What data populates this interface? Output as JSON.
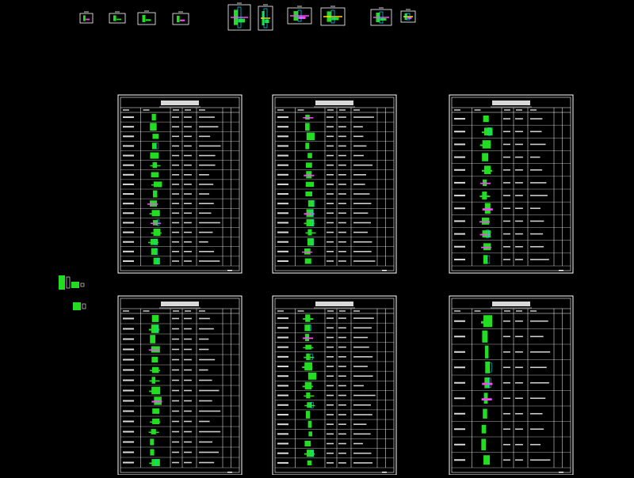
{
  "colors": {
    "background": "#000000",
    "frame": "#ffffff",
    "title": "#ff4040",
    "part": "#22dd22",
    "accent": "#ff44ff",
    "highlight": "#ffdd00",
    "cyan": "#00e5ff",
    "muted": "#9a9a9a"
  },
  "sheets": [
    {
      "title": "",
      "header": [
        "",
        "",
        "",
        "",
        ""
      ],
      "rows": 16
    },
    {
      "title": "",
      "header": [
        "",
        "",
        "",
        "",
        ""
      ],
      "rows": 16
    },
    {
      "title": "",
      "header": [
        "",
        "",
        "",
        "",
        ""
      ],
      "rows": 12
    },
    {
      "title": "",
      "header": [
        "",
        "",
        "",
        "",
        ""
      ],
      "rows": 15
    },
    {
      "title": "",
      "header": [
        "",
        "",
        "",
        "",
        ""
      ],
      "rows": 16
    },
    {
      "title": "",
      "header": [
        "",
        "",
        "",
        "",
        ""
      ],
      "rows": 10
    }
  ]
}
